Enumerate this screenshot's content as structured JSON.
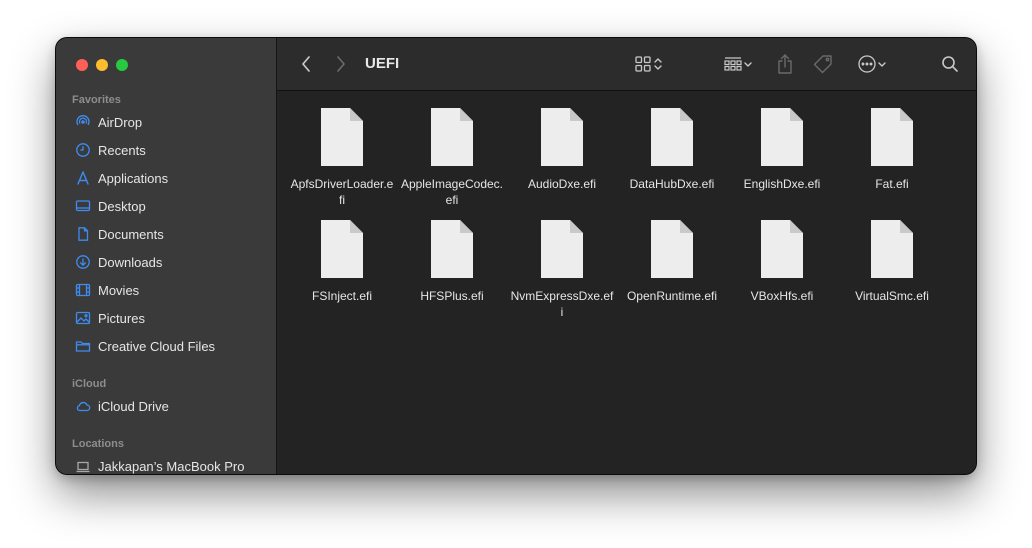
{
  "window": {
    "title": "UEFI"
  },
  "sidebar": {
    "sections": [
      {
        "label": "Favorites",
        "items": [
          {
            "label": "AirDrop",
            "icon": "airdrop-icon"
          },
          {
            "label": "Recents",
            "icon": "clock-icon"
          },
          {
            "label": "Applications",
            "icon": "applications-icon"
          },
          {
            "label": "Desktop",
            "icon": "desktop-icon"
          },
          {
            "label": "Documents",
            "icon": "document-icon"
          },
          {
            "label": "Downloads",
            "icon": "download-icon"
          },
          {
            "label": "Movies",
            "icon": "film-icon"
          },
          {
            "label": "Pictures",
            "icon": "photo-icon"
          },
          {
            "label": "Creative Cloud Files",
            "icon": "folder-icon"
          }
        ]
      },
      {
        "label": "iCloud",
        "items": [
          {
            "label": "iCloud Drive",
            "icon": "cloud-icon"
          }
        ]
      },
      {
        "label": "Locations",
        "items": [
          {
            "label": "Jakkapan’s MacBook Pro",
            "icon": "laptop-icon"
          }
        ]
      }
    ]
  },
  "files": [
    {
      "name": "ApfsDriverLoader.efi"
    },
    {
      "name": "AppleImageCodec.efi"
    },
    {
      "name": "AudioDxe.efi"
    },
    {
      "name": "DataHubDxe.efi"
    },
    {
      "name": "EnglishDxe.efi"
    },
    {
      "name": "Fat.efi"
    },
    {
      "name": "FSInject.efi"
    },
    {
      "name": "HFSPlus.efi"
    },
    {
      "name": "NvmExpressDxe.efi"
    },
    {
      "name": "OpenRuntime.efi"
    },
    {
      "name": "VBoxHfs.efi"
    },
    {
      "name": "VirtualSmc.efi"
    }
  ],
  "colors": {
    "accent": "#3d8cf0",
    "close": "#fe5f57",
    "minimize": "#febc2e",
    "maximize": "#28c840"
  }
}
